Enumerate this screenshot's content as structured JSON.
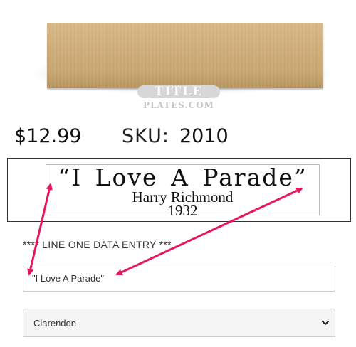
{
  "product": {
    "image_alt": "Wood title plate"
  },
  "logo": {
    "title": "TITLE",
    "sub": "PLATES.COM"
  },
  "price": "$12.99",
  "sku": {
    "label": "SKU:",
    "value": "2010"
  },
  "preview": {
    "line1": "“I Love A Parade”",
    "line2": "Harry Richmond",
    "line3": "1932"
  },
  "entry": {
    "label": "**** LINE ONE DATA ENTRY ***",
    "value": "\"I Love A Parade\"",
    "placeholder": ""
  },
  "font_select": {
    "selected": "Clarendon"
  },
  "colors": {
    "annotation_arrow": "#e8175d",
    "plate": "#cfae7a"
  }
}
